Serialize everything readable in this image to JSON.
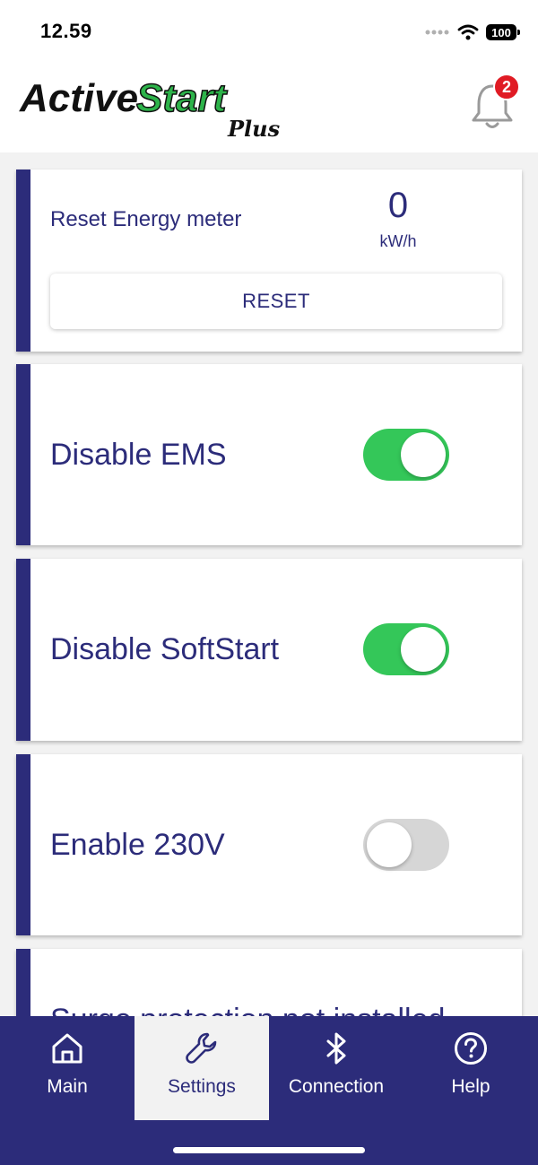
{
  "status_bar": {
    "time": "12.59",
    "battery": "100"
  },
  "header": {
    "logo_text_main_1": "Active",
    "logo_text_main_2": "Start",
    "logo_text_sub": "Plus",
    "notification_count": "2"
  },
  "reset_card": {
    "label": "Reset Energy meter",
    "value": "0",
    "unit": "kW/h",
    "button_label": "RESET"
  },
  "toggles": [
    {
      "label": "Disable EMS",
      "on": true
    },
    {
      "label": "Disable SoftStart",
      "on": true
    },
    {
      "label": "Enable 230V",
      "on": false
    }
  ],
  "partial_card": {
    "label": "Surge protection not installed"
  },
  "tabs": [
    {
      "label": "Main",
      "icon": "home-icon",
      "active": false
    },
    {
      "label": "Settings",
      "icon": "wrench-icon",
      "active": true
    },
    {
      "label": "Connection",
      "icon": "bluetooth-icon",
      "active": false
    },
    {
      "label": "Help",
      "icon": "help-circle-icon",
      "active": false
    }
  ],
  "colors": {
    "brand_navy": "#2c2c7a",
    "brand_green": "#2db34a",
    "switch_on": "#34c759",
    "switch_off": "#d6d6d6",
    "badge_red": "#e01b24"
  }
}
